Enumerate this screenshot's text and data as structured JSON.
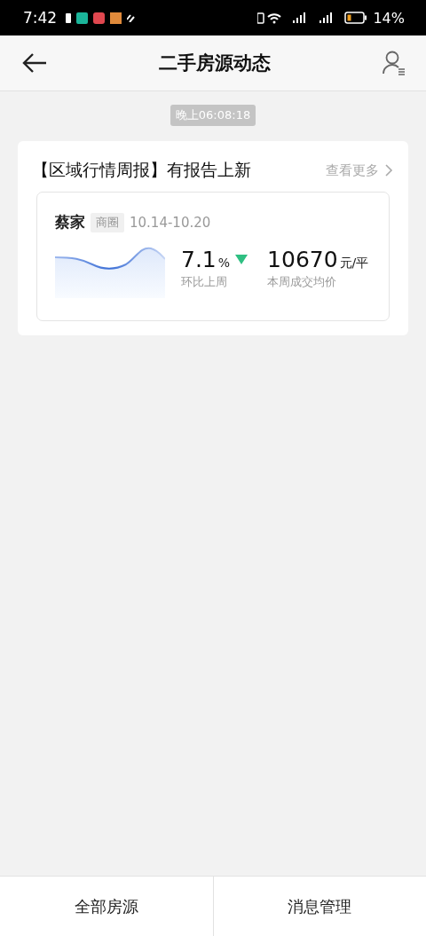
{
  "status_bar": {
    "time": "7:42",
    "battery": "14%"
  },
  "header": {
    "title": "二手房源动态"
  },
  "messages": [
    {
      "timestamp": "晚上06:08:18",
      "title": "【区域行情周报】有报告上新",
      "more": "查看更多",
      "report": {
        "area": "蔡家",
        "tag": "商圈",
        "dates": "10.14-10.20",
        "change": "7.1",
        "change_unit": "%",
        "falling": true,
        "change_label": "环比上周",
        "price": "10670",
        "price_unit": "元/平",
        "price_label": "本周成交均价"
      }
    }
  ],
  "bottom_bar": [
    {
      "label": "全部房源"
    },
    {
      "label": "消息管理"
    }
  ]
}
